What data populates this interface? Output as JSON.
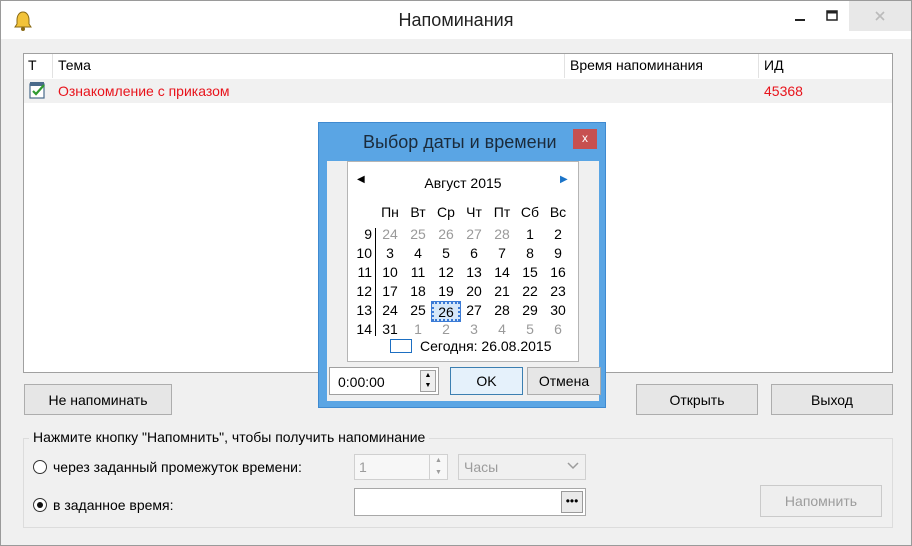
{
  "window": {
    "title": "Напоминания",
    "icon": "bell-icon"
  },
  "list": {
    "columns": [
      "Т",
      "Тема",
      "Время напоминания",
      "ИД"
    ],
    "rows": [
      {
        "icon": "task-check-icon",
        "subject": "Ознакомление с приказом",
        "time": "",
        "id": "45368"
      }
    ]
  },
  "buttons": {
    "dont_remind": "Не напоминать",
    "open": "Открыть",
    "exit": "Выход",
    "remind": "Напомнить"
  },
  "reminder_group": {
    "title": "Нажмите кнопку \"Напомнить\", чтобы получить напоминание",
    "option_interval": "через заданный промежуток времени:",
    "option_time": "в заданное время:",
    "interval_value": "1",
    "interval_unit": "Часы",
    "datetime_value": "",
    "selected_option": "time"
  },
  "dialog": {
    "title": "Выбор даты и времени",
    "close_label": "x",
    "month_label": "Август 2015",
    "day_names": [
      "Пн",
      "Вт",
      "Ср",
      "Чт",
      "Пт",
      "Сб",
      "Вс"
    ],
    "weeks": [
      {
        "num": "9",
        "days": [
          {
            "d": "24",
            "o": true
          },
          {
            "d": "25",
            "o": true
          },
          {
            "d": "26",
            "o": true
          },
          {
            "d": "27",
            "o": true
          },
          {
            "d": "28",
            "o": true
          },
          {
            "d": "1"
          },
          {
            "d": "2"
          }
        ]
      },
      {
        "num": "10",
        "days": [
          {
            "d": "3"
          },
          {
            "d": "4"
          },
          {
            "d": "5"
          },
          {
            "d": "6"
          },
          {
            "d": "7"
          },
          {
            "d": "8"
          },
          {
            "d": "9"
          }
        ]
      },
      {
        "num": "11",
        "days": [
          {
            "d": "10"
          },
          {
            "d": "11"
          },
          {
            "d": "12"
          },
          {
            "d": "13"
          },
          {
            "d": "14"
          },
          {
            "d": "15"
          },
          {
            "d": "16"
          }
        ]
      },
      {
        "num": "12",
        "days": [
          {
            "d": "17"
          },
          {
            "d": "18"
          },
          {
            "d": "19"
          },
          {
            "d": "20"
          },
          {
            "d": "21"
          },
          {
            "d": "22"
          },
          {
            "d": "23"
          }
        ]
      },
      {
        "num": "13",
        "days": [
          {
            "d": "24"
          },
          {
            "d": "25"
          },
          {
            "d": "26",
            "s": true
          },
          {
            "d": "27"
          },
          {
            "d": "28"
          },
          {
            "d": "29"
          },
          {
            "d": "30"
          }
        ]
      },
      {
        "num": "14",
        "days": [
          {
            "d": "31"
          },
          {
            "d": "1",
            "o": true
          },
          {
            "d": "2",
            "o": true
          },
          {
            "d": "3",
            "o": true
          },
          {
            "d": "4",
            "o": true
          },
          {
            "d": "5",
            "o": true
          },
          {
            "d": "6",
            "o": true
          }
        ]
      }
    ],
    "today_label": "Сегодня: 26.08.2015",
    "time_value": "0:00:00",
    "ok_label": "OK",
    "cancel_label": "Отмена"
  },
  "colors": {
    "accent_blue": "#5aa5e4",
    "row_text_red": "#e8141c",
    "close_red": "#c75050"
  }
}
